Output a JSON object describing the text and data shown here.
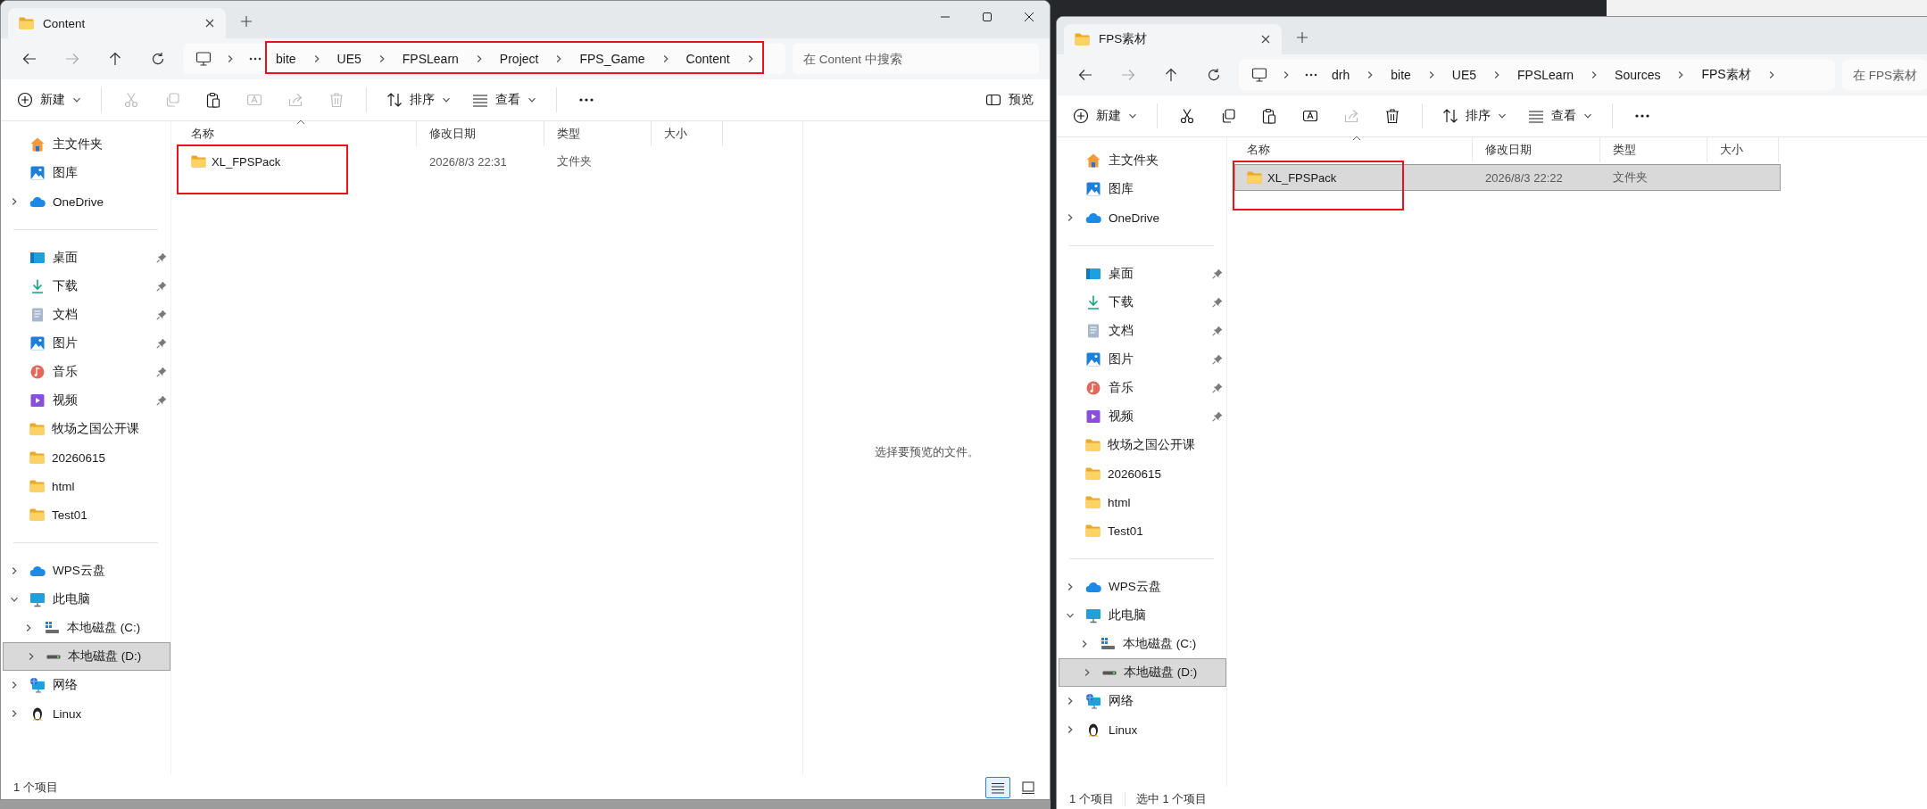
{
  "windows": [
    {
      "tab": {
        "title": "Content",
        "selected": true
      },
      "controls": [
        {
          "kind": "minimize"
        },
        {
          "kind": "maximize"
        },
        {
          "kind": "close"
        }
      ],
      "breadcrumbs": [
        "bite",
        "UE5",
        "FPSLearn",
        "Project",
        "FPS_Game",
        "Content"
      ],
      "breadcrumbs_highlighted": true,
      "search": {
        "placeholder": "在 Content 中搜索"
      },
      "toolbar": [
        [
          {
            "kind": "new",
            "label": "新建",
            "disabled": false
          }
        ],
        [
          {
            "kind": "cut",
            "disabled": true
          },
          {
            "kind": "copy",
            "disabled": true
          },
          {
            "kind": "paste",
            "disabled": false
          },
          {
            "kind": "rename",
            "disabled": true
          },
          {
            "kind": "share",
            "disabled": true
          },
          {
            "kind": "delete",
            "disabled": true
          }
        ],
        [
          {
            "kind": "sort",
            "label": "排序",
            "disabled": false
          },
          {
            "kind": "view",
            "label": "查看",
            "disabled": false
          }
        ],
        [
          {
            "kind": "more",
            "disabled": false
          }
        ]
      ],
      "preview_button": {
        "label": "预览"
      },
      "sidebar": [
        {
          "items": [
            {
              "kind": "home",
              "label": "主文件夹",
              "selected": false
            },
            {
              "kind": "gallery",
              "label": "图库",
              "selected": false
            },
            {
              "kind": "cloud",
              "label": "OneDrive",
              "selected": false,
              "expanded": false
            }
          ]
        },
        {
          "items": [
            {
              "kind": "desktop",
              "label": "桌面",
              "selected": false,
              "pinned": true
            },
            {
              "kind": "download",
              "label": "下载",
              "selected": false,
              "pinned": true
            },
            {
              "kind": "documents",
              "label": "文档",
              "selected": false,
              "pinned": true
            },
            {
              "kind": "pictures",
              "label": "图片",
              "selected": false,
              "pinned": true
            },
            {
              "kind": "music",
              "label": "音乐",
              "selected": false,
              "pinned": true
            },
            {
              "kind": "videos",
              "label": "视频",
              "selected": false,
              "pinned": true
            },
            {
              "kind": "folder",
              "label": "牧场之国公开课",
              "selected": false,
              "pinned": false
            },
            {
              "kind": "folder",
              "label": "20260615",
              "selected": false,
              "pinned": false
            },
            {
              "kind": "folder",
              "label": "html",
              "selected": false,
              "pinned": false
            },
            {
              "kind": "folder",
              "label": "Test01",
              "selected": false,
              "pinned": false
            }
          ]
        },
        {
          "items": [
            {
              "kind": "cloud",
              "label": "WPS云盘",
              "selected": false,
              "expanded": false
            },
            {
              "kind": "computer",
              "label": "此电脑",
              "selected": false,
              "expanded": true,
              "children": [
                {
                  "kind": "drive-system",
                  "label": "本地磁盘 (C:)",
                  "selected": false,
                  "expanded": false
                },
                {
                  "kind": "drive",
                  "label": "本地磁盘 (D:)",
                  "selected": true,
                  "expanded": false
                }
              ]
            },
            {
              "kind": "network",
              "label": "网络",
              "selected": false,
              "expanded": false
            },
            {
              "kind": "linux",
              "label": "Linux",
              "selected": false,
              "expanded": false
            }
          ]
        }
      ],
      "columns": [
        {
          "label": "名称",
          "sorted": true
        },
        {
          "label": "修改日期",
          "sorted": false
        },
        {
          "label": "类型",
          "sorted": false
        },
        {
          "label": "大小",
          "sorted": false
        }
      ],
      "rows": [
        {
          "name": "XL_FPSPack",
          "modified": "2026/8/3 22:31",
          "type": "文件夹",
          "selected": false,
          "highlighted": true
        }
      ],
      "preview_pane": {
        "message": "选择要预览的文件。"
      },
      "status": {
        "items": [
          "1 个项目"
        ],
        "view_modes": [
          {
            "kind": "details",
            "selected": true
          },
          {
            "kind": "tiles",
            "selected": false
          }
        ]
      }
    },
    {
      "tab": {
        "title": "FPS素材",
        "selected": true
      },
      "breadcrumbs": [
        "drh",
        "bite",
        "UE5",
        "FPSLearn",
        "Sources",
        "FPS素材"
      ],
      "search": {
        "placeholder": "在 FPS素材"
      },
      "toolbar": [
        [
          {
            "kind": "new",
            "label": "新建",
            "disabled": false
          }
        ],
        [
          {
            "kind": "cut",
            "disabled": false
          },
          {
            "kind": "copy",
            "disabled": false
          },
          {
            "kind": "paste",
            "disabled": false
          },
          {
            "kind": "rename",
            "disabled": false
          },
          {
            "kind": "share",
            "disabled": true
          },
          {
            "kind": "delete",
            "disabled": false
          }
        ],
        [
          {
            "kind": "sort",
            "label": "排序",
            "disabled": false
          },
          {
            "kind": "view",
            "label": "查看",
            "disabled": false
          }
        ],
        [
          {
            "kind": "more",
            "disabled": false
          }
        ]
      ],
      "sidebar": [
        {
          "items": [
            {
              "kind": "home",
              "label": "主文件夹",
              "selected": false
            },
            {
              "kind": "gallery",
              "label": "图库",
              "selected": false
            },
            {
              "kind": "cloud",
              "label": "OneDrive",
              "selected": false,
              "expanded": false
            }
          ]
        },
        {
          "items": [
            {
              "kind": "desktop",
              "label": "桌面",
              "selected": false,
              "pinned": true
            },
            {
              "kind": "download",
              "label": "下载",
              "selected": false,
              "pinned": true
            },
            {
              "kind": "documents",
              "label": "文档",
              "selected": false,
              "pinned": true
            },
            {
              "kind": "pictures",
              "label": "图片",
              "selected": false,
              "pinned": true
            },
            {
              "kind": "music",
              "label": "音乐",
              "selected": false,
              "pinned": true
            },
            {
              "kind": "videos",
              "label": "视频",
              "selected": false,
              "pinned": true
            },
            {
              "kind": "folder",
              "label": "牧场之国公开课",
              "selected": false,
              "pinned": false
            },
            {
              "kind": "folder",
              "label": "20260615",
              "selected": false,
              "pinned": false
            },
            {
              "kind": "folder",
              "label": "html",
              "selected": false,
              "pinned": false
            },
            {
              "kind": "folder",
              "label": "Test01",
              "selected": false,
              "pinned": false
            }
          ]
        },
        {
          "items": [
            {
              "kind": "cloud",
              "label": "WPS云盘",
              "selected": false,
              "expanded": false
            },
            {
              "kind": "computer",
              "label": "此电脑",
              "selected": false,
              "expanded": true,
              "children": [
                {
                  "kind": "drive-system",
                  "label": "本地磁盘 (C:)",
                  "selected": false,
                  "expanded": false
                },
                {
                  "kind": "drive",
                  "label": "本地磁盘 (D:)",
                  "selected": true,
                  "expanded": false
                }
              ]
            },
            {
              "kind": "network",
              "label": "网络",
              "selected": false,
              "expanded": false
            },
            {
              "kind": "linux",
              "label": "Linux",
              "selected": false,
              "expanded": false
            }
          ]
        }
      ],
      "columns": [
        {
          "label": "名称",
          "sorted": true
        },
        {
          "label": "修改日期",
          "sorted": false
        },
        {
          "label": "类型",
          "sorted": false
        },
        {
          "label": "大小",
          "sorted": false
        }
      ],
      "rows": [
        {
          "name": "XL_FPSPack",
          "modified": "2026/8/3 22:22",
          "type": "文件夹",
          "selected": true,
          "highlighted": true
        }
      ],
      "status": {
        "items": [
          "1 个项目",
          "选中 1 个项目"
        ]
      }
    }
  ]
}
